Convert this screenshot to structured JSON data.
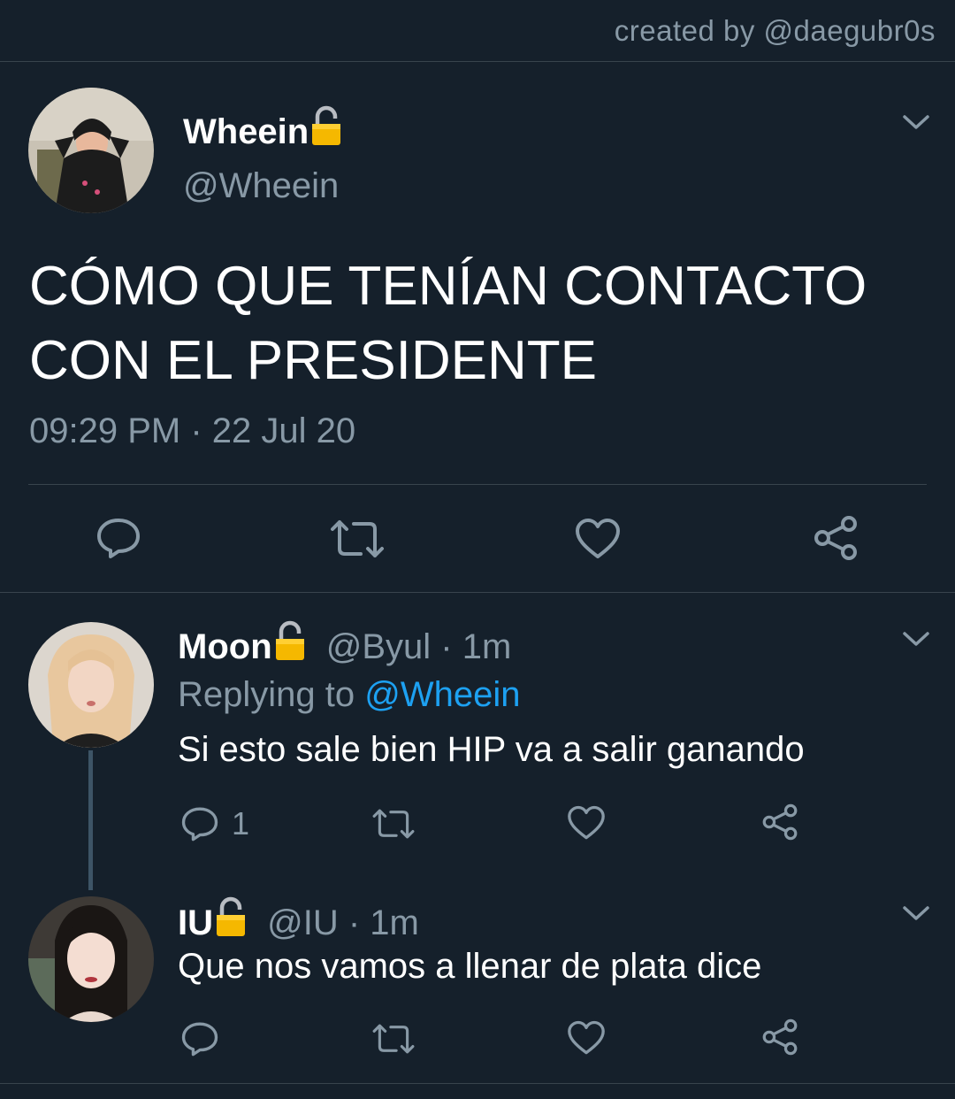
{
  "credit": "created by @daegubr0s",
  "main_tweet": {
    "name": "Wheein",
    "handle": "@Wheein",
    "text_line1": "CÓMO QUE TENÍAN CONTACTO",
    "text_line2": "CON EL PRESIDENTE",
    "timestamp": "09:29 PM · 22 Jul 20",
    "actions": [
      "reply-icon",
      "retweet-icon",
      "like-icon",
      "share-icon"
    ]
  },
  "replies": [
    {
      "name": "Moon",
      "handle": "@Byul",
      "time": "· 1m",
      "replying_prefix": "Replying to",
      "replying_to": "@Wheein",
      "text": "Si esto sale bien HIP va a salir ganando",
      "reply_count": "1"
    },
    {
      "name": "IU",
      "handle": "@IU",
      "time": "· 1m",
      "text": "Que nos vamos a llenar de plata dice",
      "reply_count": ""
    }
  ],
  "colors": {
    "background": "#15202b",
    "secondary_text": "#8899a6",
    "link": "#1da1f2",
    "divider": "#38444d",
    "lock": "#f5b800"
  }
}
